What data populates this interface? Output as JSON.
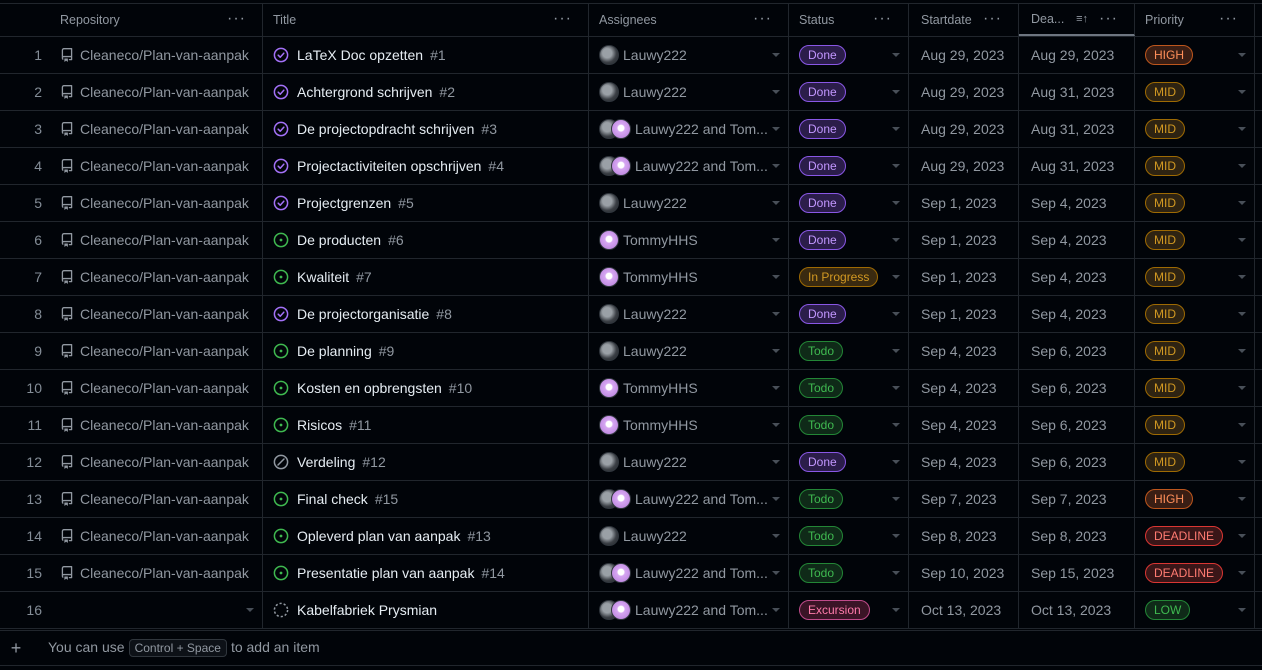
{
  "headers": {
    "repository": "Repository",
    "title": "Title",
    "assignees": "Assignees",
    "status": "Status",
    "startdate": "Startdate",
    "deadline": "Dea...",
    "priority": "Priority",
    "menu_icon": "ellipsis-icon",
    "sort_icon": "sort-ascending-icon"
  },
  "rows": [
    {
      "n": "1",
      "repo": "Cleaneco/Plan-van-aanpak",
      "title": "LaTeX Doc opzetten",
      "num": "#1",
      "icon": "closed",
      "assignees": "Lauwy222",
      "av": [
        "gray"
      ],
      "status": "Done",
      "start": "Aug 29, 2023",
      "dead": "Aug 29, 2023",
      "prio": "HIGH"
    },
    {
      "n": "2",
      "repo": "Cleaneco/Plan-van-aanpak",
      "title": "Achtergrond schrijven",
      "num": "#2",
      "icon": "closed",
      "assignees": "Lauwy222",
      "av": [
        "gray"
      ],
      "status": "Done",
      "start": "Aug 29, 2023",
      "dead": "Aug 31, 2023",
      "prio": "MID"
    },
    {
      "n": "3",
      "repo": "Cleaneco/Plan-van-aanpak",
      "title": "De projectopdracht schrijven",
      "num": "#3",
      "icon": "closed",
      "assignees": "Lauwy222 and Tom...",
      "av": [
        "gray",
        "pink"
      ],
      "status": "Done",
      "start": "Aug 29, 2023",
      "dead": "Aug 31, 2023",
      "prio": "MID"
    },
    {
      "n": "4",
      "repo": "Cleaneco/Plan-van-aanpak",
      "title": "Projectactiviteiten opschrijven",
      "num": "#4",
      "icon": "closed",
      "assignees": "Lauwy222 and Tom...",
      "av": [
        "gray",
        "pink"
      ],
      "status": "Done",
      "start": "Aug 29, 2023",
      "dead": "Aug 31, 2023",
      "prio": "MID"
    },
    {
      "n": "5",
      "repo": "Cleaneco/Plan-van-aanpak",
      "title": "Projectgrenzen",
      "num": "#5",
      "icon": "closed",
      "assignees": "Lauwy222",
      "av": [
        "gray"
      ],
      "status": "Done",
      "start": "Sep 1, 2023",
      "dead": "Sep 4, 2023",
      "prio": "MID"
    },
    {
      "n": "6",
      "repo": "Cleaneco/Plan-van-aanpak",
      "title": "De producten",
      "num": "#6",
      "icon": "open",
      "assignees": "TommyHHS",
      "av": [
        "pink"
      ],
      "status": "Done",
      "start": "Sep 1, 2023",
      "dead": "Sep 4, 2023",
      "prio": "MID"
    },
    {
      "n": "7",
      "repo": "Cleaneco/Plan-van-aanpak",
      "title": "Kwaliteit",
      "num": "#7",
      "icon": "open",
      "assignees": "TommyHHS",
      "av": [
        "pink"
      ],
      "status": "In Progress",
      "start": "Sep 1, 2023",
      "dead": "Sep 4, 2023",
      "prio": "MID"
    },
    {
      "n": "8",
      "repo": "Cleaneco/Plan-van-aanpak",
      "title": "De projectorganisatie",
      "num": "#8",
      "icon": "closed",
      "assignees": "Lauwy222",
      "av": [
        "gray"
      ],
      "status": "Done",
      "start": "Sep 1, 2023",
      "dead": "Sep 4, 2023",
      "prio": "MID"
    },
    {
      "n": "9",
      "repo": "Cleaneco/Plan-van-aanpak",
      "title": "De planning",
      "num": "#9",
      "icon": "open",
      "assignees": "Lauwy222",
      "av": [
        "gray"
      ],
      "status": "Todo",
      "start": "Sep 4, 2023",
      "dead": "Sep 6, 2023",
      "prio": "MID"
    },
    {
      "n": "10",
      "repo": "Cleaneco/Plan-van-aanpak",
      "title": "Kosten en opbrengsten",
      "num": "#10",
      "icon": "open",
      "assignees": "TommyHHS",
      "av": [
        "pink"
      ],
      "status": "Todo",
      "start": "Sep 4, 2023",
      "dead": "Sep 6, 2023",
      "prio": "MID"
    },
    {
      "n": "11",
      "repo": "Cleaneco/Plan-van-aanpak",
      "title": "Risicos",
      "num": "#11",
      "icon": "open",
      "assignees": "TommyHHS",
      "av": [
        "pink"
      ],
      "status": "Todo",
      "start": "Sep 4, 2023",
      "dead": "Sep 6, 2023",
      "prio": "MID"
    },
    {
      "n": "12",
      "repo": "Cleaneco/Plan-van-aanpak",
      "title": "Verdeling",
      "num": "#12",
      "icon": "notplanned",
      "assignees": "Lauwy222",
      "av": [
        "gray"
      ],
      "status": "Done",
      "start": "Sep 4, 2023",
      "dead": "Sep 6, 2023",
      "prio": "MID"
    },
    {
      "n": "13",
      "repo": "Cleaneco/Plan-van-aanpak",
      "title": "Final check",
      "num": "#15",
      "icon": "open",
      "assignees": "Lauwy222 and Tom...",
      "av": [
        "gray",
        "pink"
      ],
      "status": "Todo",
      "start": "Sep 7, 2023",
      "dead": "Sep 7, 2023",
      "prio": "HIGH"
    },
    {
      "n": "14",
      "repo": "Cleaneco/Plan-van-aanpak",
      "title": "Opleverd plan van aanpak",
      "num": "#13",
      "icon": "open",
      "assignees": "Lauwy222",
      "av": [
        "gray"
      ],
      "status": "Todo",
      "start": "Sep 8, 2023",
      "dead": "Sep 8, 2023",
      "prio": "DEADLINE"
    },
    {
      "n": "15",
      "repo": "Cleaneco/Plan-van-aanpak",
      "title": "Presentatie plan van aanpak",
      "num": "#14",
      "icon": "open",
      "assignees": "Lauwy222 and Tom...",
      "av": [
        "gray",
        "pink"
      ],
      "status": "Todo",
      "start": "Sep 10, 2023",
      "dead": "Sep 15, 2023",
      "prio": "DEADLINE"
    },
    {
      "n": "16",
      "repo": "",
      "title": "Kabelfabriek Prysmian",
      "num": "",
      "icon": "draft",
      "assignees": "Lauwy222 and Tom...",
      "av": [
        "gray",
        "pink"
      ],
      "status": "Excursion",
      "start": "Oct 13, 2023",
      "dead": "Oct 13, 2023",
      "prio": "LOW"
    }
  ],
  "footer": {
    "prefix": "You can use",
    "shortcut": "Control + Space",
    "suffix": "to add an item"
  },
  "status_colors": {
    "Done": "#8957e5",
    "In Progress": "#9e6a03",
    "Todo": "#238636",
    "Excursion": "#bf4b8a"
  },
  "priority_colors": {
    "HIGH": "#bd561d",
    "MID": "#9e6a03",
    "DEADLINE": "#da3633",
    "LOW": "#238636"
  }
}
